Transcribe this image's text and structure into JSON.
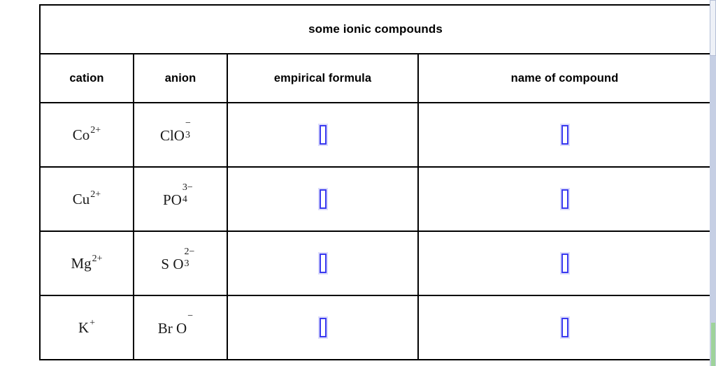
{
  "table": {
    "title": "some ionic compounds",
    "columns": [
      {
        "key": "cation",
        "label": "cation"
      },
      {
        "key": "anion",
        "label": "anion"
      },
      {
        "key": "formula",
        "label": "empirical formula"
      },
      {
        "key": "name",
        "label": "name of compound"
      }
    ],
    "rows": [
      {
        "cation": {
          "base": "Co",
          "sup": "2+"
        },
        "anion": {
          "base": "ClO",
          "sup": "−",
          "sub": "3",
          "spaced": false
        },
        "formula": {
          "placeholder": "missing-glyph"
        },
        "name": {
          "placeholder": "missing-glyph"
        }
      },
      {
        "cation": {
          "base": "Cu",
          "sup": "2+"
        },
        "anion": {
          "base": "PO",
          "sup": "3−",
          "sub": "4",
          "spaced": false
        },
        "formula": {
          "placeholder": "missing-glyph"
        },
        "name": {
          "placeholder": "missing-glyph"
        }
      },
      {
        "cation": {
          "base": "Mg",
          "sup": "2+"
        },
        "anion": {
          "base": "S O",
          "sup": "2−",
          "sub": "3",
          "spaced": true
        },
        "formula": {
          "placeholder": "missing-glyph"
        },
        "name": {
          "placeholder": "missing-glyph"
        }
      },
      {
        "cation": {
          "base": "K",
          "sup": "+"
        },
        "anion": {
          "base": "Br O",
          "sup": "−",
          "sub": "",
          "spaced": true
        },
        "formula": {
          "placeholder": "missing-glyph"
        },
        "name": {
          "placeholder": "missing-glyph"
        }
      }
    ]
  },
  "colors": {
    "border": "#000000",
    "text": "#000000",
    "placeholder_box": "#3b3bf0",
    "placeholder_halo": "#dcdcfb",
    "scrollbar_track": "#c6cfe4",
    "scrollbar_thumb": "#eef1f7",
    "scrollbar_marker": "#9ed39b",
    "background": "#ffffff"
  },
  "scrollbar": {
    "present": true,
    "orientation": "vertical",
    "position": "right"
  }
}
